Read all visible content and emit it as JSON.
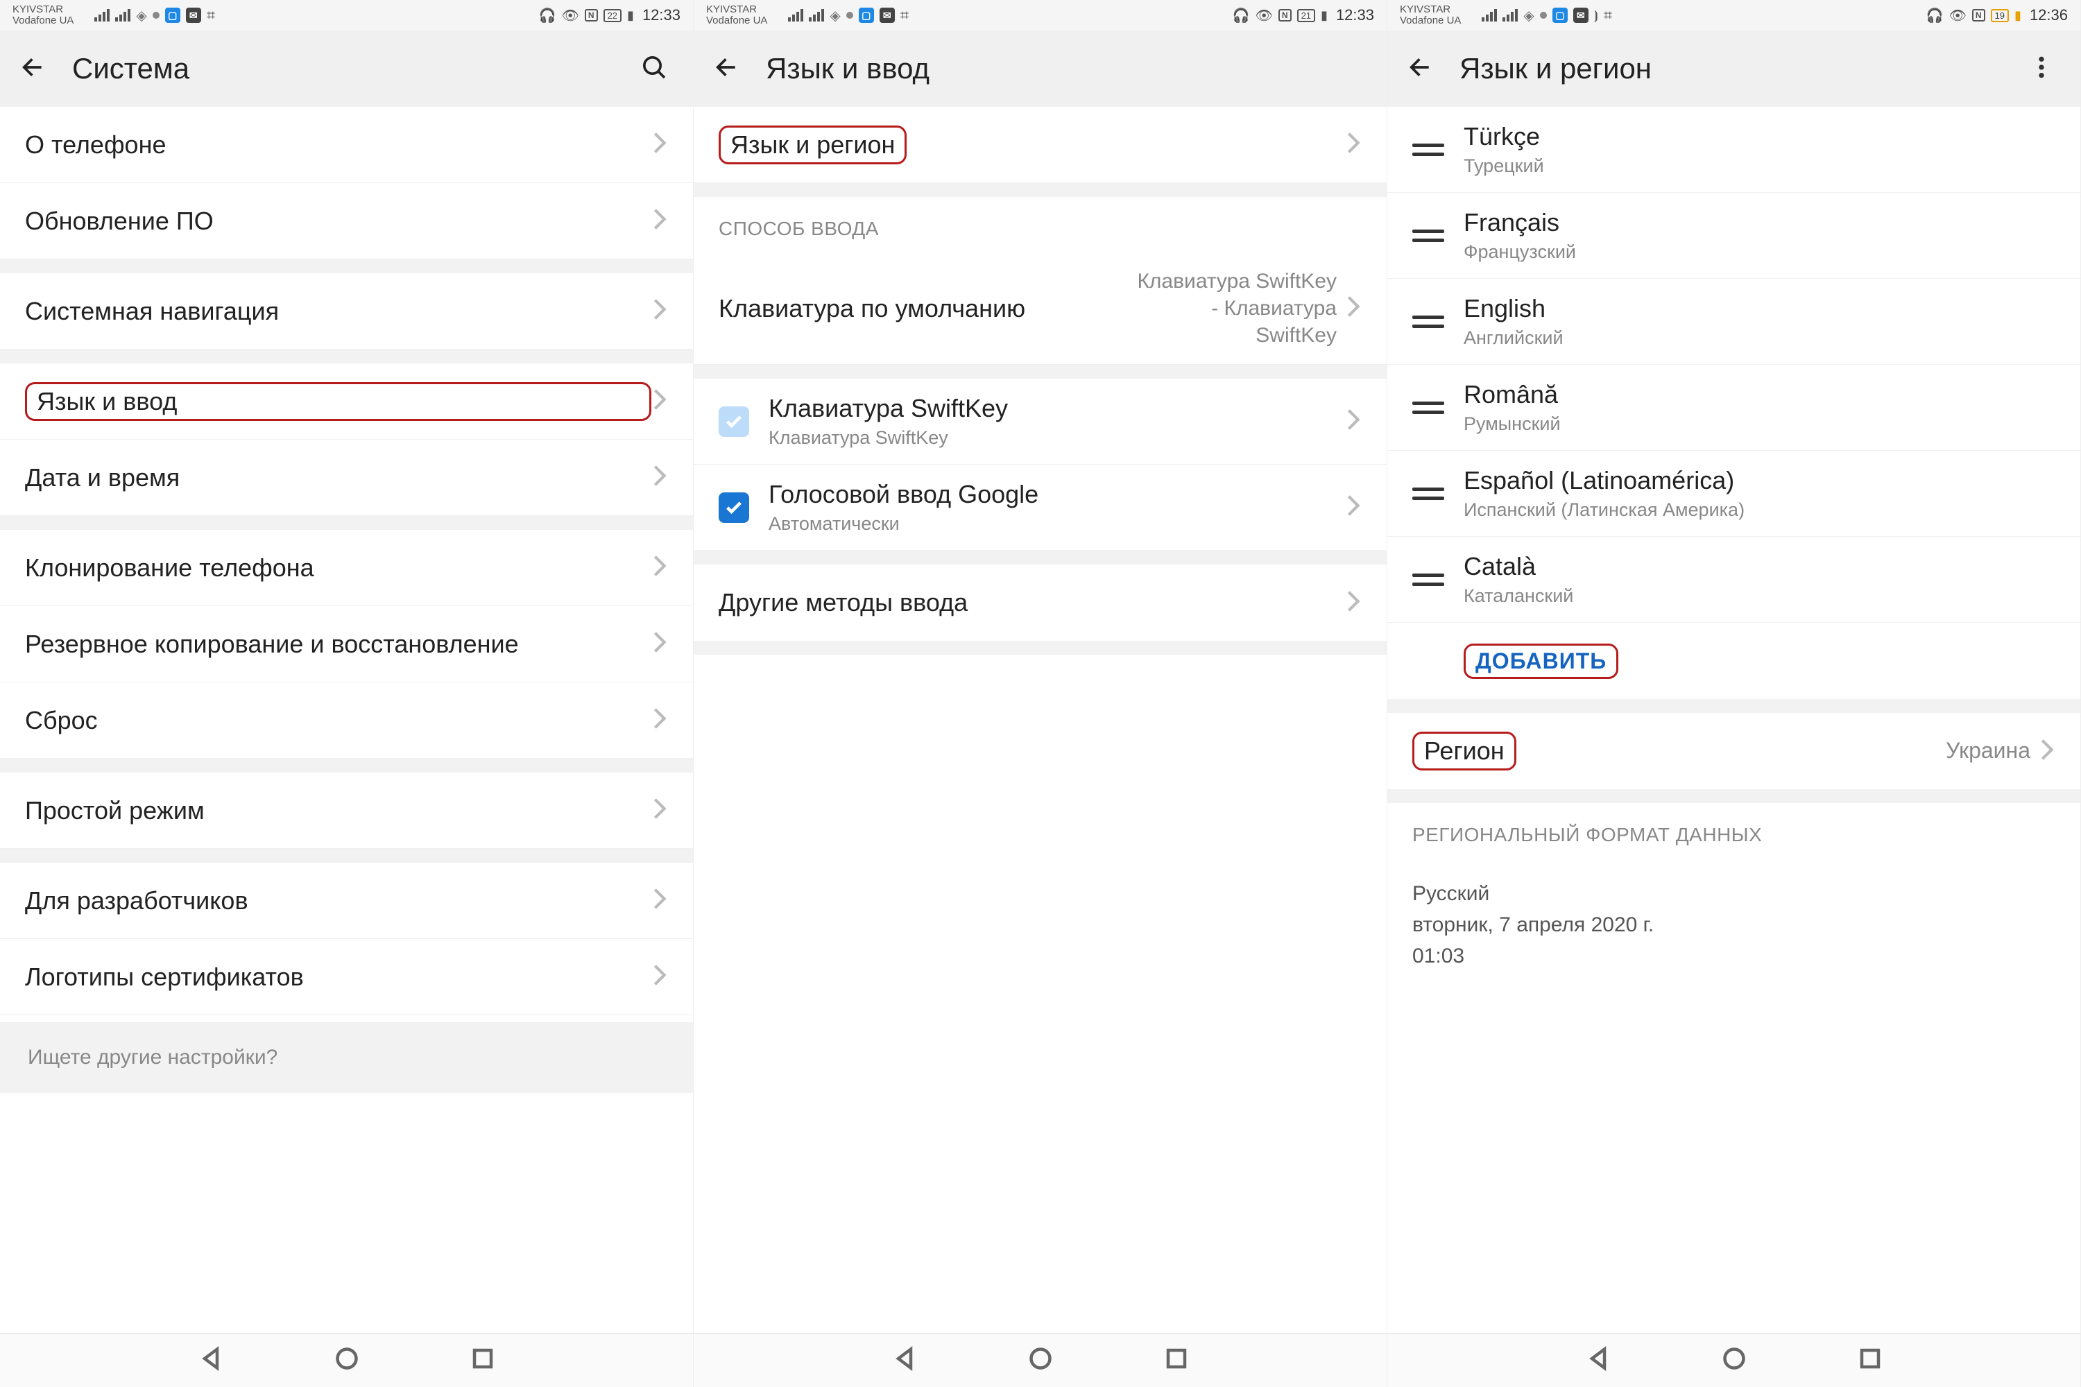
{
  "statusbar": {
    "carrier1": "KYIVSTAR",
    "carrier2": "Vodafone UA",
    "nfc": "N",
    "battery_s1": "22",
    "battery_s2": "21",
    "battery_s3": "19",
    "time_s12": "12:33",
    "time_s3": "12:36",
    "battery_icon": "▮"
  },
  "screen1": {
    "title": "Система",
    "items": [
      "О телефоне",
      "Обновление ПО",
      "Системная навигация",
      "Язык и ввод",
      "Дата и время",
      "Клонирование телефона",
      "Резервное копирование и восстановление",
      "Сброс",
      "Простой режим",
      "Для разработчиков",
      "Логотипы сертификатов"
    ],
    "search_hint": "Ищете другие настройки?"
  },
  "screen2": {
    "title": "Язык и ввод",
    "lang_region": "Язык и регион",
    "input_method_header": "СПОСОБ ВВОДА",
    "default_kb_label": "Клавиатура по умолчанию",
    "default_kb_value": "Клавиатура SwiftKey - Клавиатура SwiftKey",
    "kb1_label": "Клавиатура SwiftKey",
    "kb1_sub": "Клавиатура SwiftKey",
    "kb2_label": "Голосовой ввод Google",
    "kb2_sub": "Автоматически",
    "other": "Другие методы ввода"
  },
  "screen3": {
    "title": "Язык и регион",
    "languages": [
      {
        "name": "Türkçe",
        "sub": "Турецкий"
      },
      {
        "name": "Français",
        "sub": "Французский"
      },
      {
        "name": "English",
        "sub": "Английский"
      },
      {
        "name": "Română",
        "sub": "Румынский"
      },
      {
        "name": "Español (Latinoamérica)",
        "sub": "Испанский (Латинская Америка)"
      },
      {
        "name": "Català",
        "sub": "Каталанский"
      }
    ],
    "add": "ДОБАВИТЬ",
    "region_label": "Регион",
    "region_value": "Украина",
    "format_header": "РЕГИОНАЛЬНЫЙ ФОРМАТ ДАННЫХ",
    "format_lang": "Русский",
    "format_date": "вторник, 7 апреля 2020 г.",
    "format_time": "01:03"
  }
}
